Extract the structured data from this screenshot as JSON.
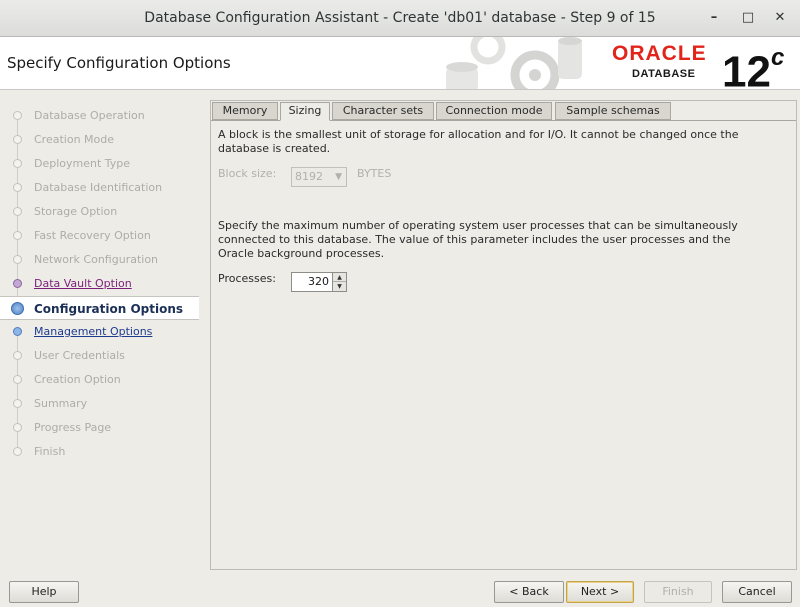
{
  "window": {
    "title": "Database Configuration Assistant - Create 'db01' database - Step 9 of 15"
  },
  "header": {
    "page_title": "Specify Configuration Options",
    "logo_brand": "ORACLE",
    "logo_sub": "DATABASE",
    "version_main": "12",
    "version_sup": "c"
  },
  "steps": [
    {
      "label": "Database Operation",
      "state": "done"
    },
    {
      "label": "Creation Mode",
      "state": "done"
    },
    {
      "label": "Deployment Type",
      "state": "done"
    },
    {
      "label": "Database Identification",
      "state": "done"
    },
    {
      "label": "Storage Option",
      "state": "done"
    },
    {
      "label": "Fast Recovery Option",
      "state": "done"
    },
    {
      "label": "Network Configuration",
      "state": "done"
    },
    {
      "label": "Data Vault Option",
      "state": "visited"
    },
    {
      "label": "Configuration Options",
      "state": "current"
    },
    {
      "label": "Management Options",
      "state": "next"
    },
    {
      "label": "User Credentials",
      "state": "pending"
    },
    {
      "label": "Creation Option",
      "state": "pending"
    },
    {
      "label": "Summary",
      "state": "pending"
    },
    {
      "label": "Progress Page",
      "state": "pending"
    },
    {
      "label": "Finish",
      "state": "pending"
    }
  ],
  "tabs": [
    {
      "label": "Memory"
    },
    {
      "label": "Sizing",
      "active": true
    },
    {
      "label": "Character sets"
    },
    {
      "label": "Connection mode"
    },
    {
      "label": "Sample schemas"
    }
  ],
  "sizing": {
    "block_desc_1": "A block is the smallest unit of storage for allocation and for I/O. It cannot be changed once the",
    "block_desc_2": "database is created.",
    "block_size_label": "Block size:",
    "block_size_value": "8192",
    "block_size_unit": "BYTES",
    "proc_desc_1": "Specify the maximum number of operating system user processes that can be simultaneously",
    "proc_desc_2": "connected to this database. The value of this parameter includes the user processes and the",
    "proc_desc_3": "Oracle background processes.",
    "processes_label": "Processes:",
    "processes_value": "320"
  },
  "buttons": {
    "help": "Help",
    "back": "< Back",
    "next": "Next >",
    "finish": "Finish",
    "cancel": "Cancel"
  },
  "colors": {
    "oracle_red": "#e1251b",
    "current_step": "#1c2f56",
    "visited_step": "#7b1e7a",
    "next_step": "#1f3b8f"
  }
}
